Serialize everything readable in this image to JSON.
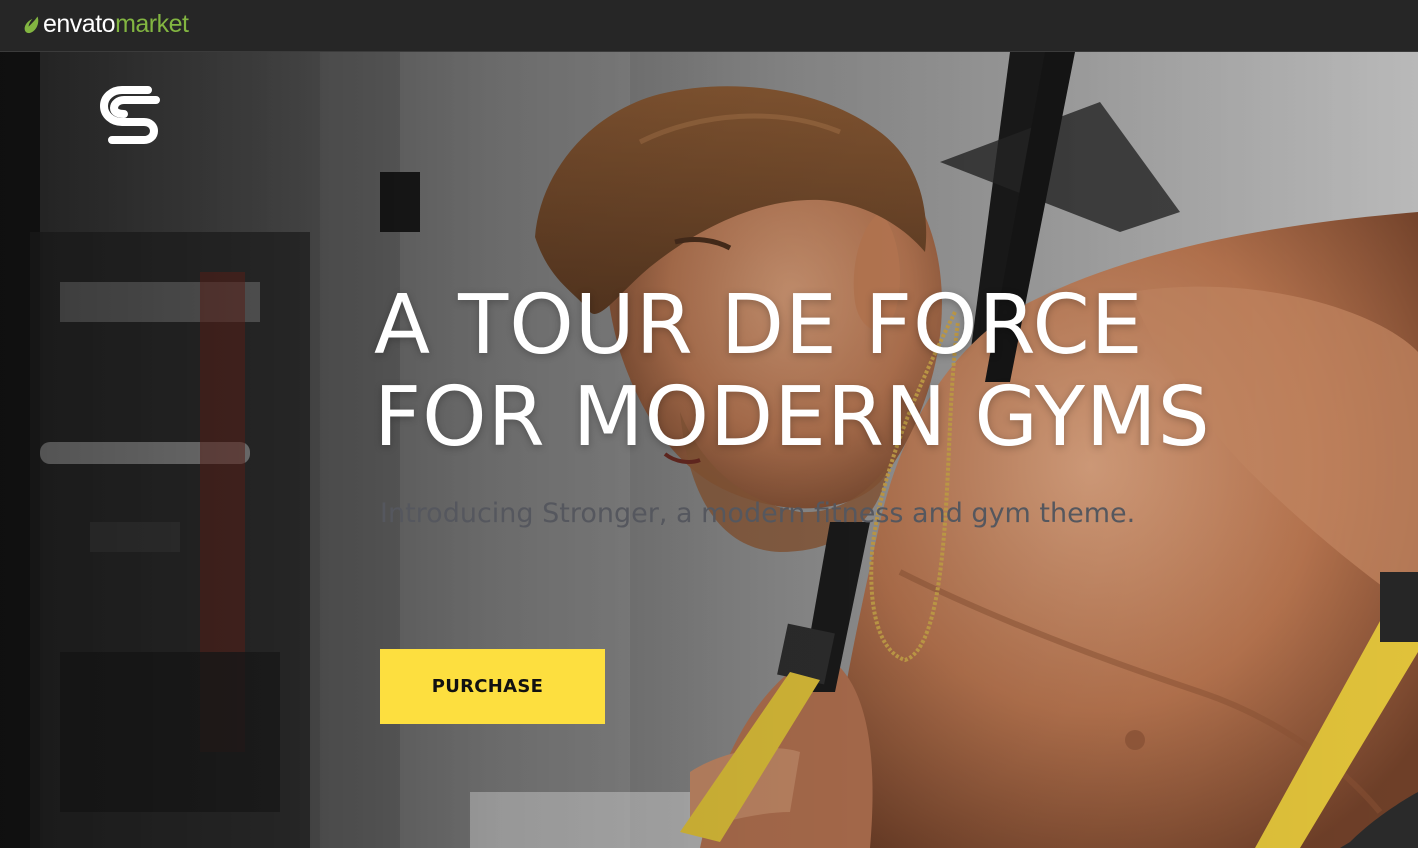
{
  "topbar": {
    "brand_main": "envato",
    "brand_sub": "market",
    "icon": "envato-leaf-icon",
    "brand_color": "#82b541"
  },
  "hero": {
    "logo_icon": "stronger-s-logo-icon",
    "headline_line1": "A TOUR DE FORCE",
    "headline_line2": "FOR MODERN GYMS",
    "subtitle": "Introducing Stronger, a modern fitness and gym theme.",
    "purchase_label": "PURCHASE",
    "accent_color": "#fddf3f"
  }
}
